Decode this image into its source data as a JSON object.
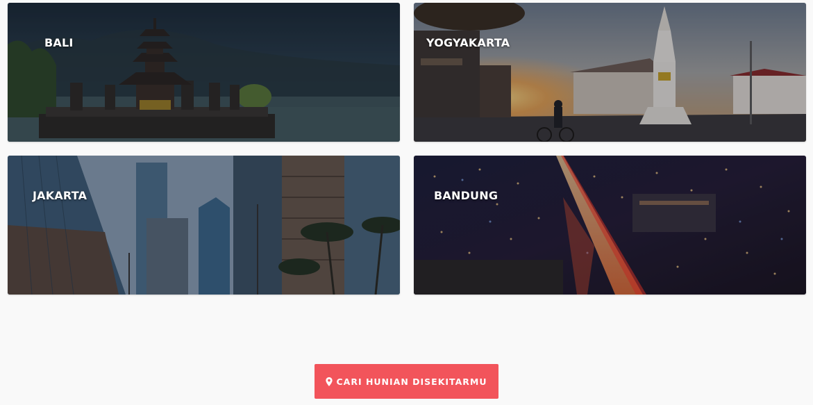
{
  "cities": [
    {
      "name": "BALI"
    },
    {
      "name": "YOGYAKARTA"
    },
    {
      "name": "JAKARTA"
    },
    {
      "name": "BANDUNG"
    }
  ],
  "cta": {
    "label": "CARI HUNIAN DISEKITARMU",
    "icon": "map-marker-icon",
    "color": "#f2545b"
  }
}
